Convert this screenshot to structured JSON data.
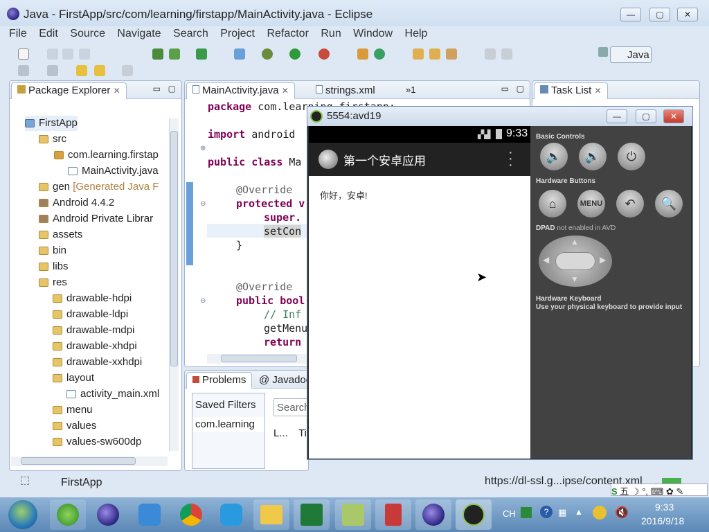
{
  "window": {
    "title": "Java - FirstApp/src/com/learning/firstapp/MainActivity.java - Eclipse",
    "min": "▭",
    "max": "▢",
    "close": "✕"
  },
  "menu": [
    "File",
    "Edit",
    "Source",
    "Navigate",
    "Search",
    "Project",
    "Refactor",
    "Run",
    "Window",
    "Help"
  ],
  "perspective": {
    "label": "Java"
  },
  "package_explorer": {
    "title": "Package Explorer",
    "items": [
      {
        "label": "FirstApp"
      },
      {
        "label": "src"
      },
      {
        "label": "com.learning.firstap"
      },
      {
        "label": "MainActivity.java"
      },
      {
        "label": "gen",
        "suffix": "[Generated Java F"
      },
      {
        "label": "Android 4.4.2"
      },
      {
        "label": "Android Private Librar"
      },
      {
        "label": "assets"
      },
      {
        "label": "bin"
      },
      {
        "label": "libs"
      },
      {
        "label": "res"
      },
      {
        "label": "drawable-hdpi"
      },
      {
        "label": "drawable-ldpi"
      },
      {
        "label": "drawable-mdpi"
      },
      {
        "label": "drawable-xhdpi"
      },
      {
        "label": "drawable-xxhdpi"
      },
      {
        "label": "layout"
      },
      {
        "label": "activity_main.xml"
      },
      {
        "label": "menu"
      },
      {
        "label": "values"
      },
      {
        "label": "values-sw600dp"
      }
    ]
  },
  "editor": {
    "tabs": [
      "MainActivity.java",
      "strings.xml",
      "»1"
    ],
    "lines": {
      "l1a": "package",
      "l1b": " com.learning.firstapp;",
      "l2a": "import",
      "l2b": " android",
      "l3a": "public class",
      "l3b": " Ma",
      "l4": "@Override",
      "l5": "protected v",
      "l6": "super.",
      "l7": "setCon",
      "l8": "}",
      "l9": "@Override",
      "l10": "public bool",
      "l11": "// Inf",
      "l12": "getMenu",
      "l13": "return"
    }
  },
  "task_list": {
    "title": "Task List"
  },
  "bottom_panel": {
    "tabs": [
      "Problems",
      "Javadoc"
    ],
    "saved_filters": "Saved Filters",
    "filter_item": "com.learning",
    "search": "Search",
    "col1": "L...",
    "col2": "Ti"
  },
  "status_bar": {
    "selection": "FirstApp",
    "url": "https://dl-ssl.g...ipse/content.xml"
  },
  "emulator": {
    "title": "5554:avd19",
    "time": "9:33",
    "app_title": "第一个安卓应用",
    "content": "你好，安卓!",
    "basic_controls": "Basic Controls",
    "hardware_buttons": "Hardware Buttons",
    "menu_btn": "MENU",
    "dpad_label": "DPAD",
    "dpad_note": "not enabled in AVD",
    "hw_keyboard": "Hardware Keyboard",
    "hw_keyboard_note": "Use your physical keyboard to provide input"
  },
  "taskbar": {
    "lang": "CH",
    "time": "9:33",
    "date": "2016/9/18",
    "ime": "五"
  },
  "colors": {
    "keyword": "#7f0055",
    "comment": "#3f7f5f",
    "titlebar": "#cfdff0",
    "android_actionbar": "#222222"
  }
}
